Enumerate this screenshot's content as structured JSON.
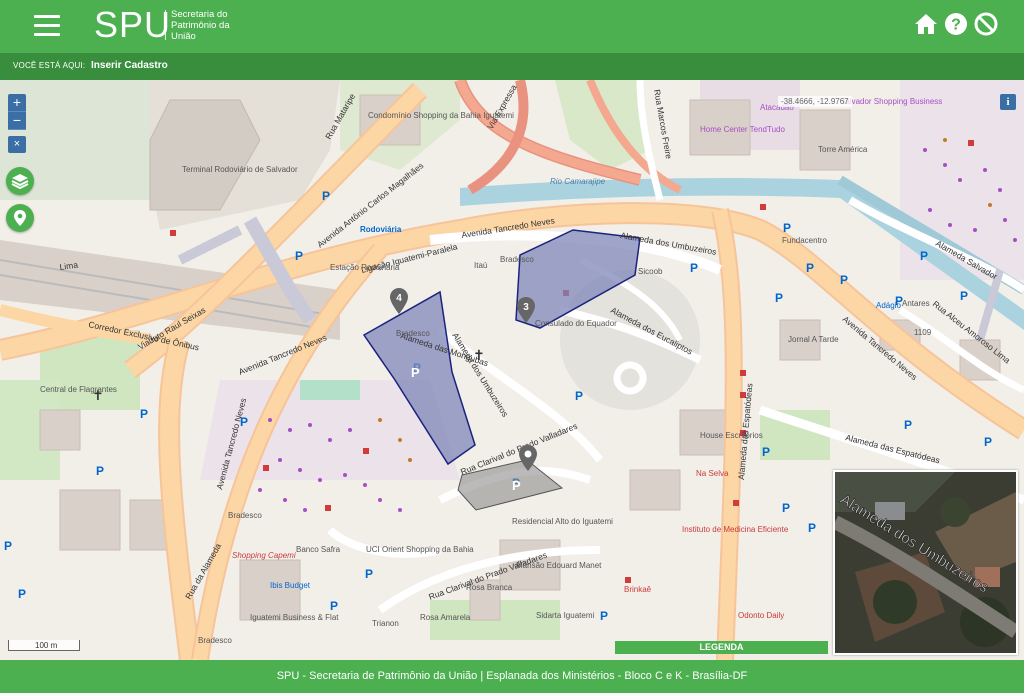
{
  "header": {
    "logo": "SPU",
    "subtitle_line1": "Secretaria do",
    "subtitle_line2": "Patrimônio da",
    "subtitle_line3": "União",
    "icons": [
      "home-icon",
      "help-icon",
      "logout-icon"
    ]
  },
  "breadcrumb": {
    "label": "VOCÊ ESTÁ AQUI:",
    "current": "Inserir Cadastro"
  },
  "map": {
    "zoom_in": "+",
    "zoom_out": "−",
    "close": "×",
    "info": "i",
    "coords": "-38.4666, -12.9767",
    "scale": "100 m",
    "legend": "LEGENDA",
    "markers": [
      "4",
      "3"
    ],
    "street_labels": {
      "avenida_tancredo_neves_top": "Avenida Tancredo Neves",
      "avenida_tancredo_neves_left": "Avenida Tancredo Neves",
      "avenida_tancredo_neves_right": "Avenida Tancredo Neves",
      "avenida_tancredo_neves_bottom": "Avenida Tancredo Neves",
      "avenida_acm": "Avenida Antônio Carlos Magalhães",
      "ligacao": "Ligação Iguatemi-Paralela",
      "viaduto": "Viaduto Raul Seixas",
      "corredor": "Corredor Exclusivo de Ônibus",
      "alameda_umbuzeiros_top": "Alameda dos Umbuzeiros",
      "alameda_umbuzeiros_mid": "Alameda dos Umbuzeiros",
      "alameda_eucaliptos": "Alameda dos Eucaliptos",
      "alameda_mongubas": "Alameda das Mongubas",
      "alameda_espatodeas": "Alameda das Espatódeas",
      "alameda_espatodeas_2": "Alameda das Espatódeas",
      "alameda_salvador": "Alameda Salvador",
      "rua_clarival": "Rua Clarival do Prado Valladares",
      "rua_clarival_2": "Rua Clarival do Prado Valladares",
      "rua_marcos_freire": "Rua Marcos Freire",
      "rio_camarajipe": "Rio Camarajipe",
      "via_expressa": "Via Expressa",
      "rua_mataripe": "Rua Mataripe",
      "rua_alceu": "Rua Alceu Amoroso Lima",
      "rua_alameda": "Rua da Alameda",
      "lima": "Lima"
    },
    "place_labels": {
      "terminal": "Terminal Rodoviário de Salvador",
      "rodoviaria": "Rodoviária",
      "estacao": "Estação Rodoviária",
      "condominio": "Condomínio Shopping da Bahia Iguatemi",
      "home_center": "Home Center TendTudo",
      "atacadao": "Atacadão",
      "torre_america": "Torre América",
      "fundacentro": "Fundacentro",
      "salvador_business": "Salvador Shopping Business",
      "itau": "Itaú",
      "bradesco_top": "Bradesco",
      "bradesco_mid": "Bradesco",
      "bradesco_bl": "Bradesco",
      "bradesco_b": "Bradesco",
      "sicoob": "Sicoob",
      "consulado": "Consulado do Equador",
      "central_flagrantes": "Central de Flagrantes",
      "jornal": "Jornal A Tarde",
      "antares": "Antares",
      "adagio": "Adágio",
      "house": "House Escritórios",
      "residencial": "Residencial Alto do Iguatemi",
      "mansao": "Mansão Edouard Manet",
      "rosa_branca": "Rosa Branca",
      "rosa_amarela": "Rosa Amarela",
      "sidarta": "Sidarta Iguatemi",
      "banco_safra": "Banco Safra",
      "uci": "UCI Orient Shopping da Bahia",
      "shopping_capemi": "Shopping Capemi",
      "ibis": "Ibis Budget",
      "iguatemi_business": "Iguatemi Business & Flat",
      "na_selva": "Na Selva",
      "instituto": "Instituto de Medicina Eficiente",
      "brinkae": "Brinkaê",
      "odonto": "Odonto Daily",
      "trianon": "Trianon",
      "num_1109": "1109"
    },
    "minimap_label": "Alameda dos Umbuzeiros"
  },
  "footer": {
    "text": "SPU - Secretaria de Patrimônio da União | Esplanada dos Ministérios - Bloco C e K - Brasília-DF"
  },
  "colors": {
    "brand_green": "#4caf50",
    "breadcrumb_green": "#388e3c",
    "polygon_fill": "#7f87b8",
    "polygon_stroke": "#1a237e"
  }
}
